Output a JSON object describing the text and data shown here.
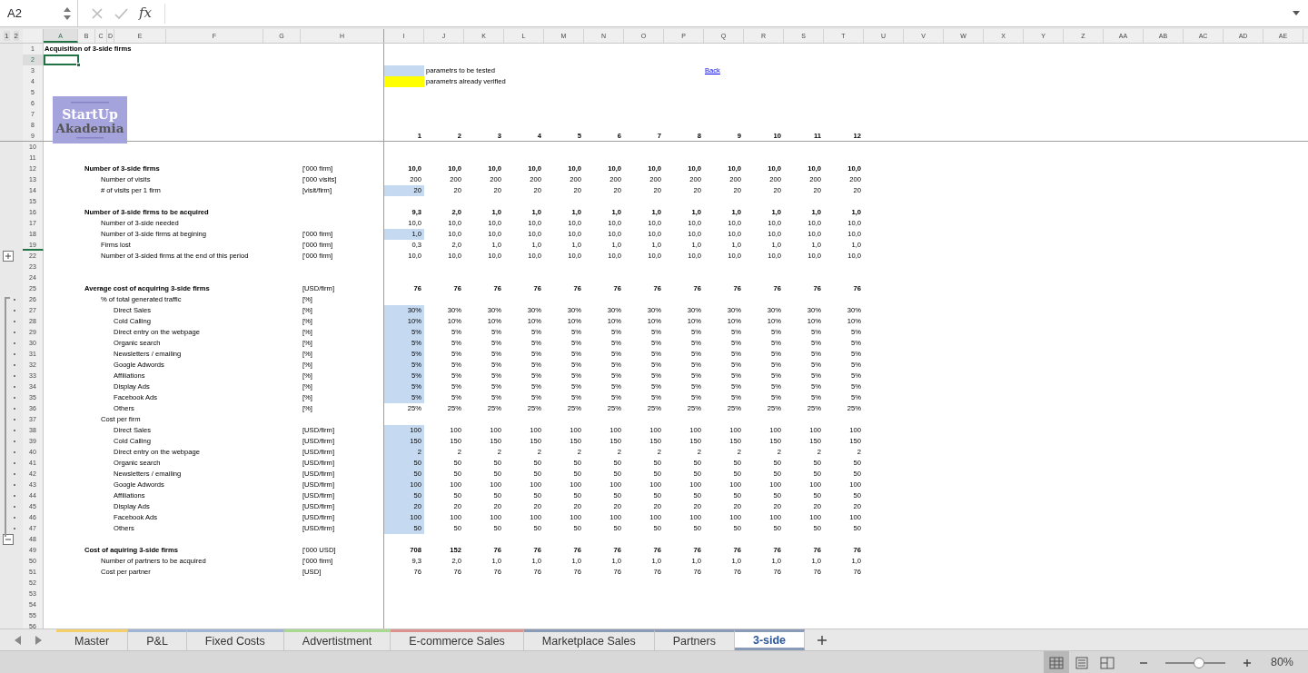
{
  "formula_bar": {
    "name_box": "A2",
    "function_label": "fx"
  },
  "outline_levels": [
    "1",
    "2"
  ],
  "columns": [
    {
      "label": "A",
      "selected": true
    },
    {
      "label": "B",
      "selected": false
    },
    {
      "label": "C",
      "selected": false
    },
    {
      "label": "D",
      "selected": false
    },
    {
      "label": "E",
      "selected": false
    },
    {
      "label": "F",
      "selected": false
    },
    {
      "label": "G",
      "selected": false
    },
    {
      "label": "H",
      "selected": false
    },
    {
      "label": "I",
      "selected": false
    },
    {
      "label": "J",
      "selected": false
    },
    {
      "label": "K",
      "selected": false
    },
    {
      "label": "L",
      "selected": false
    },
    {
      "label": "M",
      "selected": false
    },
    {
      "label": "N",
      "selected": false
    },
    {
      "label": "O",
      "selected": false
    },
    {
      "label": "P",
      "selected": false
    },
    {
      "label": "Q",
      "selected": false
    },
    {
      "label": "R",
      "selected": false
    },
    {
      "label": "S",
      "selected": false
    },
    {
      "label": "T",
      "selected": false
    },
    {
      "label": "U",
      "selected": false
    },
    {
      "label": "V",
      "selected": false
    },
    {
      "label": "W",
      "selected": false
    },
    {
      "label": "X",
      "selected": false
    },
    {
      "label": "Y",
      "selected": false
    },
    {
      "label": "Z",
      "selected": false
    },
    {
      "label": "AA",
      "selected": false
    },
    {
      "label": "AB",
      "selected": false
    },
    {
      "label": "AC",
      "selected": false
    },
    {
      "label": "AD",
      "selected": false
    },
    {
      "label": "AE",
      "selected": false
    }
  ],
  "logo": {
    "line1": "StartUp",
    "line2": "Akademia"
  },
  "rows": [
    {
      "n": "1",
      "kind": "title",
      "label": "Acquisition of 3-side firms",
      "selected": false
    },
    {
      "n": "2",
      "selected": true
    },
    {
      "n": "3",
      "selected": false,
      "legend": {
        "label": "parametrs to be tested",
        "color": "#c5d9f1"
      },
      "link": "Back"
    },
    {
      "n": "4",
      "selected": false,
      "legend": {
        "label": "parametrs already verified",
        "color": "#ffff00"
      }
    },
    {
      "n": "5",
      "selected": false
    },
    {
      "n": "6",
      "selected": false
    },
    {
      "n": "7",
      "selected": false
    },
    {
      "n": "8",
      "selected": false
    },
    {
      "n": "9",
      "kind": "heading",
      "selected": false,
      "frozen_below": true,
      "values": [
        "1",
        "2",
        "3",
        "4",
        "5",
        "6",
        "7",
        "8",
        "9",
        "10",
        "11",
        "12"
      ]
    },
    {
      "n": "10",
      "selected": false
    },
    {
      "n": "11",
      "selected": false
    },
    {
      "n": "12",
      "kind": "heading",
      "label": "Number of 3-side firms",
      "unit": "['000 firm]",
      "selected": false,
      "input": false,
      "values": [
        "10,0",
        "10,0",
        "10,0",
        "10,0",
        "10,0",
        "10,0",
        "10,0",
        "10,0",
        "10,0",
        "10,0",
        "10,0",
        "10,0"
      ]
    },
    {
      "n": "13",
      "kind": "item",
      "label": "Number of visits",
      "unit": "['000 visits]",
      "selected": false,
      "input": false,
      "values": [
        "200",
        "200",
        "200",
        "200",
        "200",
        "200",
        "200",
        "200",
        "200",
        "200",
        "200",
        "200"
      ]
    },
    {
      "n": "14",
      "kind": "item",
      "label": "# of visits per 1 firm",
      "unit": "[visit/firm]",
      "selected": false,
      "input": true,
      "values": [
        "20",
        "20",
        "20",
        "20",
        "20",
        "20",
        "20",
        "20",
        "20",
        "20",
        "20",
        "20"
      ]
    },
    {
      "n": "15",
      "selected": false
    },
    {
      "n": "16",
      "kind": "heading",
      "label": "Number of 3-side firms to be acquired",
      "selected": false,
      "input": false,
      "values": [
        "9,3",
        "2,0",
        "1,0",
        "1,0",
        "1,0",
        "1,0",
        "1,0",
        "1,0",
        "1,0",
        "1,0",
        "1,0",
        "1,0"
      ]
    },
    {
      "n": "17",
      "kind": "item",
      "label": "Number of 3-side needed",
      "selected": false,
      "input": false,
      "values": [
        "10,0",
        "10,0",
        "10,0",
        "10,0",
        "10,0",
        "10,0",
        "10,0",
        "10,0",
        "10,0",
        "10,0",
        "10,0",
        "10,0"
      ]
    },
    {
      "n": "18",
      "kind": "item",
      "label": "Number of 3-side firms at begining",
      "unit": "['000 firm]",
      "selected": false,
      "input": true,
      "values": [
        "1,0",
        "10,0",
        "10,0",
        "10,0",
        "10,0",
        "10,0",
        "10,0",
        "10,0",
        "10,0",
        "10,0",
        "10,0",
        "10,0"
      ]
    },
    {
      "n": "19",
      "kind": "item",
      "label": "Firms lost",
      "unit": "['000 firm]",
      "selected": false,
      "rows_hidden_below": true,
      "input": false,
      "values": [
        "0,3",
        "2,0",
        "1,0",
        "1,0",
        "1,0",
        "1,0",
        "1,0",
        "1,0",
        "1,0",
        "1,0",
        "1,0",
        "1,0"
      ]
    },
    {
      "n": "22",
      "kind": "item",
      "label": "Number of 3-sided firms at the end of this period",
      "unit": "['000 firm]",
      "selected": false,
      "expand_button": true,
      "input": false,
      "values": [
        "10,0",
        "10,0",
        "10,0",
        "10,0",
        "10,0",
        "10,0",
        "10,0",
        "10,0",
        "10,0",
        "10,0",
        "10,0",
        "10,0"
      ]
    },
    {
      "n": "23",
      "selected": false
    },
    {
      "n": "24",
      "selected": false
    },
    {
      "n": "25",
      "kind": "heading",
      "label": "Average cost of acquiring 3-side firms",
      "unit": "[USD/firm]",
      "selected": false,
      "input": false,
      "values": [
        "76",
        "76",
        "76",
        "76",
        "76",
        "76",
        "76",
        "76",
        "76",
        "76",
        "76",
        "76"
      ]
    },
    {
      "n": "26",
      "kind": "item",
      "label": "% of total generated traffic",
      "unit": "[%]",
      "selected": false,
      "in_group": true
    },
    {
      "n": "27",
      "kind": "subitem",
      "label": "Direct Sales",
      "unit": "[%]",
      "selected": false,
      "in_group": true,
      "input": true,
      "values": [
        "30%",
        "30%",
        "30%",
        "30%",
        "30%",
        "30%",
        "30%",
        "30%",
        "30%",
        "30%",
        "30%",
        "30%"
      ]
    },
    {
      "n": "28",
      "kind": "subitem",
      "label": "Cold Calling",
      "unit": "[%]",
      "selected": false,
      "in_group": true,
      "input": true,
      "values": [
        "10%",
        "10%",
        "10%",
        "10%",
        "10%",
        "10%",
        "10%",
        "10%",
        "10%",
        "10%",
        "10%",
        "10%"
      ]
    },
    {
      "n": "29",
      "kind": "subitem",
      "label": "Direct entry on the webpage",
      "unit": "[%]",
      "selected": false,
      "in_group": true,
      "input": true,
      "values": [
        "5%",
        "5%",
        "5%",
        "5%",
        "5%",
        "5%",
        "5%",
        "5%",
        "5%",
        "5%",
        "5%",
        "5%"
      ]
    },
    {
      "n": "30",
      "kind": "subitem",
      "label": "Organic search",
      "unit": "[%]",
      "selected": false,
      "in_group": true,
      "input": true,
      "values": [
        "5%",
        "5%",
        "5%",
        "5%",
        "5%",
        "5%",
        "5%",
        "5%",
        "5%",
        "5%",
        "5%",
        "5%"
      ]
    },
    {
      "n": "31",
      "kind": "subitem",
      "label": "Newsletters / emailing",
      "unit": "[%]",
      "selected": false,
      "in_group": true,
      "input": true,
      "values": [
        "5%",
        "5%",
        "5%",
        "5%",
        "5%",
        "5%",
        "5%",
        "5%",
        "5%",
        "5%",
        "5%",
        "5%"
      ]
    },
    {
      "n": "32",
      "kind": "subitem",
      "label": "Google Adwords",
      "unit": "[%]",
      "selected": false,
      "in_group": true,
      "input": true,
      "values": [
        "5%",
        "5%",
        "5%",
        "5%",
        "5%",
        "5%",
        "5%",
        "5%",
        "5%",
        "5%",
        "5%",
        "5%"
      ]
    },
    {
      "n": "33",
      "kind": "subitem",
      "label": "Affiliations",
      "unit": "[%]",
      "selected": false,
      "in_group": true,
      "input": true,
      "values": [
        "5%",
        "5%",
        "5%",
        "5%",
        "5%",
        "5%",
        "5%",
        "5%",
        "5%",
        "5%",
        "5%",
        "5%"
      ]
    },
    {
      "n": "34",
      "kind": "subitem",
      "label": "Display Ads",
      "unit": "[%]",
      "selected": false,
      "in_group": true,
      "input": true,
      "values": [
        "5%",
        "5%",
        "5%",
        "5%",
        "5%",
        "5%",
        "5%",
        "5%",
        "5%",
        "5%",
        "5%",
        "5%"
      ]
    },
    {
      "n": "35",
      "kind": "subitem",
      "label": "Facebook Ads",
      "unit": "[%]",
      "selected": false,
      "in_group": true,
      "input": true,
      "values": [
        "5%",
        "5%",
        "5%",
        "5%",
        "5%",
        "5%",
        "5%",
        "5%",
        "5%",
        "5%",
        "5%",
        "5%"
      ]
    },
    {
      "n": "36",
      "kind": "subitem",
      "label": "Others",
      "unit": "[%]",
      "selected": false,
      "in_group": true,
      "input": false,
      "values": [
        "25%",
        "25%",
        "25%",
        "25%",
        "25%",
        "25%",
        "25%",
        "25%",
        "25%",
        "25%",
        "25%",
        "25%"
      ]
    },
    {
      "n": "37",
      "kind": "item",
      "label": "Cost per firm",
      "selected": false,
      "in_group": true
    },
    {
      "n": "38",
      "kind": "subitem",
      "label": "Direct Sales",
      "unit": "[USD/firm]",
      "selected": false,
      "in_group": true,
      "input": true,
      "values": [
        "100",
        "100",
        "100",
        "100",
        "100",
        "100",
        "100",
        "100",
        "100",
        "100",
        "100",
        "100"
      ]
    },
    {
      "n": "39",
      "kind": "subitem",
      "label": "Cold Calling",
      "unit": "[USD/firm]",
      "selected": false,
      "in_group": true,
      "input": true,
      "values": [
        "150",
        "150",
        "150",
        "150",
        "150",
        "150",
        "150",
        "150",
        "150",
        "150",
        "150",
        "150"
      ]
    },
    {
      "n": "40",
      "kind": "subitem",
      "label": "Direct entry on the webpage",
      "unit": "[USD/firm]",
      "selected": false,
      "in_group": true,
      "input": true,
      "values": [
        "2",
        "2",
        "2",
        "2",
        "2",
        "2",
        "2",
        "2",
        "2",
        "2",
        "2",
        "2"
      ]
    },
    {
      "n": "41",
      "kind": "subitem",
      "label": "Organic search",
      "unit": "[USD/firm]",
      "selected": false,
      "in_group": true,
      "input": true,
      "values": [
        "50",
        "50",
        "50",
        "50",
        "50",
        "50",
        "50",
        "50",
        "50",
        "50",
        "50",
        "50"
      ]
    },
    {
      "n": "42",
      "kind": "subitem",
      "label": "Newsletters / emailing",
      "unit": "[USD/firm]",
      "selected": false,
      "in_group": true,
      "input": true,
      "values": [
        "50",
        "50",
        "50",
        "50",
        "50",
        "50",
        "50",
        "50",
        "50",
        "50",
        "50",
        "50"
      ]
    },
    {
      "n": "43",
      "kind": "subitem",
      "label": "Google Adwords",
      "unit": "[USD/firm]",
      "selected": false,
      "in_group": true,
      "input": true,
      "values": [
        "100",
        "100",
        "100",
        "100",
        "100",
        "100",
        "100",
        "100",
        "100",
        "100",
        "100",
        "100"
      ]
    },
    {
      "n": "44",
      "kind": "subitem",
      "label": "Affiliations",
      "unit": "[USD/firm]",
      "selected": false,
      "in_group": true,
      "input": true,
      "values": [
        "50",
        "50",
        "50",
        "50",
        "50",
        "50",
        "50",
        "50",
        "50",
        "50",
        "50",
        "50"
      ]
    },
    {
      "n": "45",
      "kind": "subitem",
      "label": "Display Ads",
      "unit": "[USD/firm]",
      "selected": false,
      "in_group": true,
      "input": true,
      "values": [
        "20",
        "20",
        "20",
        "20",
        "20",
        "20",
        "20",
        "20",
        "20",
        "20",
        "20",
        "20"
      ]
    },
    {
      "n": "46",
      "kind": "subitem",
      "label": "Facebook Ads",
      "unit": "[USD/firm]",
      "selected": false,
      "in_group": true,
      "input": true,
      "values": [
        "100",
        "100",
        "100",
        "100",
        "100",
        "100",
        "100",
        "100",
        "100",
        "100",
        "100",
        "100"
      ]
    },
    {
      "n": "47",
      "kind": "subitem",
      "label": "Others",
      "unit": "[USD/firm]",
      "selected": false,
      "in_group": true,
      "input": true,
      "values": [
        "50",
        "50",
        "50",
        "50",
        "50",
        "50",
        "50",
        "50",
        "50",
        "50",
        "50",
        "50"
      ]
    },
    {
      "n": "48",
      "selected": false,
      "collapse_button": true
    },
    {
      "n": "49",
      "kind": "heading",
      "label": "Cost of aquiring 3-side firms",
      "unit": "['000 USD]",
      "selected": false,
      "input": false,
      "values": [
        "708",
        "152",
        "76",
        "76",
        "76",
        "76",
        "76",
        "76",
        "76",
        "76",
        "76",
        "76"
      ]
    },
    {
      "n": "50",
      "kind": "item",
      "label": "Number of partners to be acquired",
      "unit": "['000 firm]",
      "selected": false,
      "input": false,
      "values": [
        "9,3",
        "2,0",
        "1,0",
        "1,0",
        "1,0",
        "1,0",
        "1,0",
        "1,0",
        "1,0",
        "1,0",
        "1,0",
        "1,0"
      ]
    },
    {
      "n": "51",
      "kind": "item",
      "label": "Cost per partner",
      "unit": "[USD]",
      "selected": false,
      "input": false,
      "values": [
        "76",
        "76",
        "76",
        "76",
        "76",
        "76",
        "76",
        "76",
        "76",
        "76",
        "76",
        "76"
      ]
    },
    {
      "n": "52",
      "selected": false
    },
    {
      "n": "53",
      "selected": false
    },
    {
      "n": "54",
      "selected": false
    },
    {
      "n": "55",
      "selected": false
    },
    {
      "n": "56",
      "selected": false
    }
  ],
  "sheet_tabs": [
    {
      "label": "Master",
      "color": "#f5cf6a",
      "selected": false
    },
    {
      "label": "P&L",
      "color": "#9fb5d6",
      "selected": false
    },
    {
      "label": "Fixed Costs",
      "color": "#9fb5d6",
      "selected": false
    },
    {
      "label": "Advertistment",
      "color": "#a9d88f",
      "selected": false
    },
    {
      "label": "E-commerce Sales",
      "color": "#de9290",
      "selected": false
    },
    {
      "label": "Marketplace Sales",
      "color": "#8a9bb8",
      "selected": false
    },
    {
      "label": "Partners",
      "color": "#8a9bb8",
      "selected": false
    },
    {
      "label": "3-side",
      "color": "#8a9bb8",
      "selected": true
    }
  ],
  "status_bar": {
    "views": [
      {
        "kind": "normal",
        "selected": true
      },
      {
        "kind": "page-layout",
        "selected": false
      },
      {
        "kind": "page-break",
        "selected": false
      }
    ],
    "zoom": {
      "level": 0.55,
      "reading": "80%"
    }
  }
}
